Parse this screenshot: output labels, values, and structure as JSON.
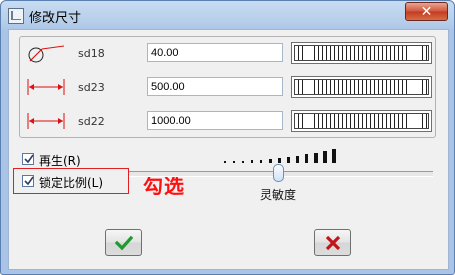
{
  "window": {
    "title": "修改尺寸",
    "close_symbol": "✕"
  },
  "dimensions": [
    {
      "name": "sd18",
      "value": "40.00",
      "icon": "diameter-icon"
    },
    {
      "name": "sd23",
      "value": "500.00",
      "icon": "linear-dimension-icon"
    },
    {
      "name": "sd22",
      "value": "1000.00",
      "icon": "linear-dimension-icon"
    }
  ],
  "options": {
    "regenerate": {
      "label": "再生(R)",
      "checked": true
    },
    "lock_scale": {
      "label": "锁定比例(L)",
      "checked": true
    }
  },
  "annotation": {
    "text": "勾选",
    "color": "#ff1010"
  },
  "sensitivity": {
    "label": "灵敏度",
    "level": 0.5
  },
  "buttons": {
    "ok": {
      "icon": "checkmark-icon",
      "color": "#1f9a2e"
    },
    "cancel": {
      "icon": "cross-icon",
      "color": "#c0161b"
    }
  }
}
